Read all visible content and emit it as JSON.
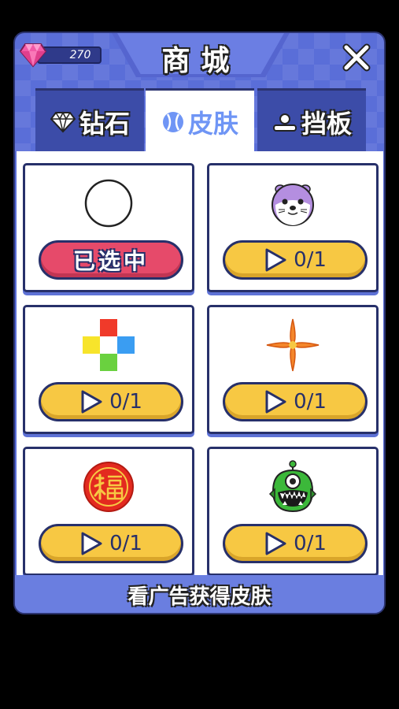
{
  "shop": {
    "title": "商城",
    "gems": "270",
    "close_icon": "close-x-icon"
  },
  "tabs": [
    {
      "label": "钻石",
      "icon": "diamond-icon",
      "active": false
    },
    {
      "label": "皮肤",
      "icon": "ball-icon",
      "active": true
    },
    {
      "label": "挡板",
      "icon": "paddle-icon",
      "active": false
    }
  ],
  "skins": [
    {
      "icon": "white-ball-icon",
      "button": "已选中",
      "state": "selected"
    },
    {
      "icon": "seal-face-icon",
      "button": "0/1",
      "state": "watch-ad"
    },
    {
      "icon": "color-cross-icon",
      "button": "0/1",
      "state": "watch-ad"
    },
    {
      "icon": "orange-shuriken-icon",
      "button": "0/1",
      "state": "watch-ad"
    },
    {
      "icon": "fu-character-icon",
      "button": "0/1",
      "state": "watch-ad"
    },
    {
      "icon": "green-monster-icon",
      "button": "0/1",
      "state": "watch-ad"
    }
  ],
  "footer": {
    "text": "看广告获得皮肤"
  },
  "colors": {
    "panel": "#5a6ed8",
    "selected_button": "#e64a6a",
    "watch_button": "#f7c843",
    "outline": "#27306a"
  }
}
